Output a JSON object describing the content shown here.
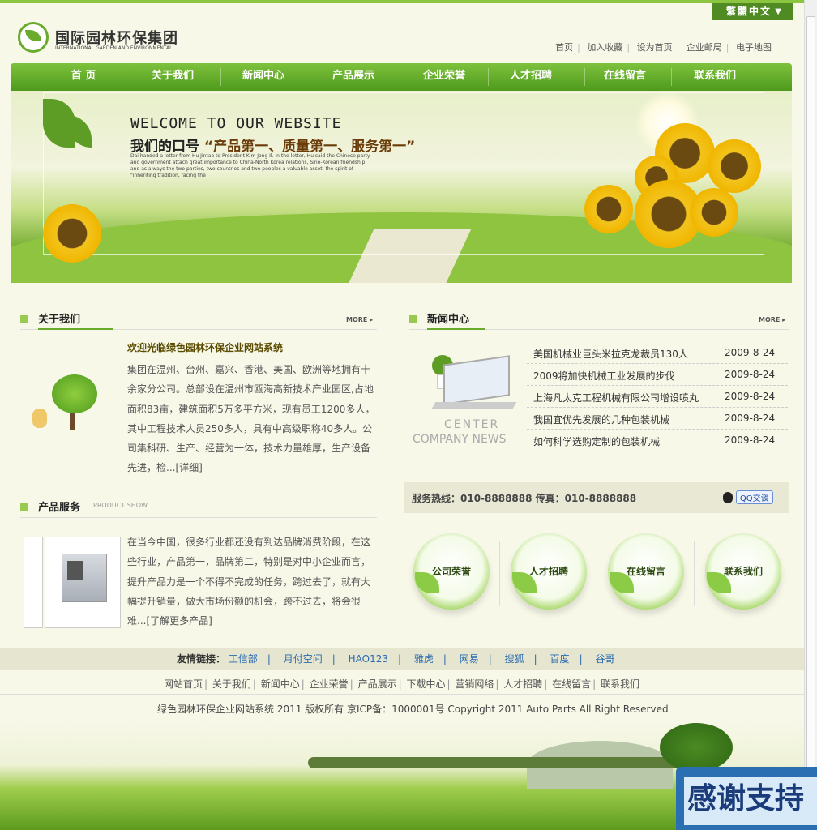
{
  "header": {
    "lang_button": "繁體中文",
    "logo_cn": "国际园林环保集团",
    "logo_en": "INTERNATIONAL GARDEN AND ENVIRONMENTAL",
    "top_links": [
      "首页",
      "加入收藏",
      "设为首页",
      "企业邮局",
      "电子地图"
    ]
  },
  "nav": [
    "首 页",
    "关于我们",
    "新闻中心",
    "产品展示",
    "企业荣誉",
    "人才招聘",
    "在线留言",
    "联系我们"
  ],
  "banner": {
    "welcome": "WELCOME TO OUR WEBSITE",
    "slogan_prefix": "我们的口号",
    "slogan_quote": "“产品第一、质量第一、服务第一”",
    "paragraph": "Dai handed a letter from Hu Jintao to President Kim Jong Il. In the letter, Hu said the Chinese party and government attach great importance to China-North Korea relations, Sino-Korean friendship and as always the two parties, two countries and two peoples a valuable asset, the spirit of \"inheriting tradition, facing the"
  },
  "about": {
    "title": "关于我们",
    "more": "MORE ▸",
    "heading": "欢迎光临绿色园林环保企业网站系统",
    "body": "集团在温州、台州、嘉兴、香港、美国、欧洲等地拥有十余家分公司。总部设在温州市瓯海高新技术产业园区,占地面积83亩，建筑面积5万多平方米，现有员工1200多人，其中工程技术人员250多人，具有中高级职称40多人。公司集科研、生产、经营为一体，技术力量雄厚，生产设备先进，检...",
    "detail_link": "[详细]"
  },
  "news": {
    "title": "新闻中心",
    "more": "MORE ▸",
    "img_text1": "CENTER",
    "img_text2": "COMPANY NEWS",
    "items": [
      {
        "title": "美国机械业巨头米拉克龙裁员130人",
        "date": "2009-8-24"
      },
      {
        "title": "2009将加快机械工业发展的步伐",
        "date": "2009-8-24"
      },
      {
        "title": "上海凡太克工程机械有限公司增设喷丸",
        "date": "2009-8-24"
      },
      {
        "title": "我国宜优先发展的几种包装机械",
        "date": "2009-8-24"
      },
      {
        "title": "如何科学选购定制的包装机械",
        "date": "2009-8-24"
      }
    ]
  },
  "hotline": {
    "text": "服务热线：010-8888888 传真：010-8888888",
    "qq": "QQ交谈"
  },
  "circles": [
    "公司荣誉",
    "人才招聘",
    "在线留言",
    "联系我们"
  ],
  "products": {
    "title": "产品服务",
    "subtitle": "PRODUCT SHOW",
    "body": "在当今中国，很多行业都还没有到达品牌消费阶段，在这些行业，产品第一，品牌第二，特别是对中小企业而言，提升产品力是一个不得不完成的任务，跨过去了，就有大幅提升销量，做大市场份额的机会，跨不过去，将会很难...",
    "more_link": "[了解更多产品]"
  },
  "friends": {
    "label": "友情链接：",
    "links": [
      "工信部",
      "月付空间",
      "HAO123",
      "雅虎",
      "网易",
      "搜狐",
      "百度",
      "谷哥"
    ]
  },
  "footer_nav": [
    "网站首页",
    "关于我们",
    "新闻中心",
    "企业荣誉",
    "产品展示",
    "下载中心",
    "营销网络",
    "人才招聘",
    "在线留言",
    "联系我们"
  ],
  "copyright": "绿色园林环保企业网站系统  2011 版权所有  京ICP备：1000001号  Copyright 2011 Auto Parts All Right Reserved",
  "thanks_banner": "感谢支持",
  "colors": {
    "accent": "#6aab2d",
    "nav": "#5aa322",
    "link": "#2a6bb0",
    "background": "#f7f8e8"
  }
}
